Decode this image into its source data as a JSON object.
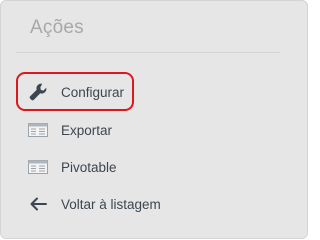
{
  "panel": {
    "title": "Ações"
  },
  "actions": [
    {
      "label": "Configurar",
      "icon": "wrench-icon"
    },
    {
      "label": "Exportar",
      "icon": "spreadsheet-icon"
    },
    {
      "label": "Pivotable",
      "icon": "spreadsheet-icon"
    },
    {
      "label": "Voltar à listagem",
      "icon": "arrow-left-icon"
    }
  ],
  "colors": {
    "panel_background": "#e6e6e6",
    "text": "#3c4650",
    "title": "#a8a8a8",
    "highlight_border": "#e0161d"
  }
}
